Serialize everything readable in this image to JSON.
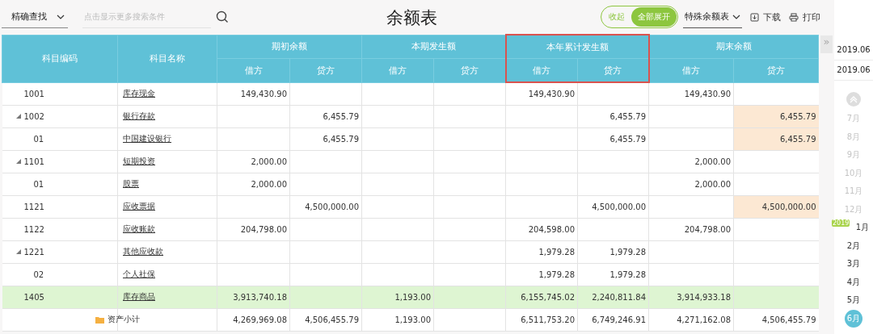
{
  "toolbar": {
    "search_mode": "精确查找",
    "search": {
      "placeholder": "点击显示更多搜索条件"
    },
    "title": "余额表",
    "toggle": [
      {
        "label": "收起",
        "selected": false
      },
      {
        "label": "全部展开",
        "selected": true
      }
    ],
    "report_type": "特殊余额表",
    "actions": [
      {
        "label": "下载",
        "kind": "download"
      },
      {
        "label": "打印",
        "kind": "print"
      }
    ]
  },
  "table": {
    "columns": [
      {
        "label": "科目编码"
      },
      {
        "label": "科目名称"
      }
    ],
    "groups": [
      {
        "label": "期初余额",
        "highlighted": false,
        "sub": [
          "借方",
          "贷方"
        ]
      },
      {
        "label": "本期发生额",
        "highlighted": false,
        "sub": [
          "借方",
          "贷方"
        ]
      },
      {
        "label": "本年累计发生额",
        "highlighted": true,
        "sub": [
          "借方",
          "贷方"
        ]
      },
      {
        "label": "期末余额",
        "highlighted": false,
        "sub": [
          "借方",
          "贷方"
        ]
      }
    ],
    "rows": [
      {
        "code": "1001",
        "name": "库存现金",
        "opening_debit": "149,430.90",
        "ytd_debit": "149,430.90",
        "closing_debit": "149,430.90",
        "highlighted": false,
        "warning": false
      },
      {
        "code": "1002",
        "name": "银行存款",
        "opening_credit": "6,455.79",
        "ytd_credit": "6,455.79",
        "closing_credit": "6,455.79",
        "highlighted": false,
        "warning": true,
        "expanded": true,
        "children": [
          {
            "code": "01",
            "name": "中国建设银行",
            "opening_credit": "6,455.79",
            "ytd_credit": "6,455.79",
            "closing_credit": "6,455.79",
            "highlighted": false,
            "warning": true
          }
        ]
      },
      {
        "code": "1101",
        "name": "短期投资",
        "opening_debit": "2,000.00",
        "closing_debit": "2,000.00",
        "highlighted": false,
        "warning": false,
        "expanded": true,
        "children": [
          {
            "code": "01",
            "name": "股票",
            "opening_debit": "2,000.00",
            "closing_debit": "2,000.00",
            "highlighted": false,
            "warning": false
          }
        ]
      },
      {
        "code": "1121",
        "name": "应收票据",
        "opening_credit": "4,500,000.00",
        "ytd_credit": "4,500,000.00",
        "closing_credit": "4,500,000.00",
        "highlighted": false,
        "warning": true
      },
      {
        "code": "1122",
        "name": "应收账款",
        "opening_debit": "204,798.00",
        "ytd_debit": "204,598.00",
        "closing_debit": "204,798.00",
        "highlighted": false,
        "warning": false
      },
      {
        "code": "1221",
        "name": "其他应收款",
        "ytd_debit": "1,979.28",
        "ytd_credit": "1,979.28",
        "highlighted": false,
        "warning": false,
        "expanded": true,
        "children": [
          {
            "code": "02",
            "name": "个人社保",
            "ytd_debit": "1,979.28",
            "ytd_credit": "1,979.28",
            "highlighted": false,
            "warning": false
          }
        ]
      },
      {
        "code": "1405",
        "name": "库存商品",
        "opening_debit": "3,913,740.18",
        "period_debit": "1,193.00",
        "ytd_debit": "6,155,745.02",
        "ytd_credit": "2,240,811.84",
        "closing_debit": "3,914,933.18",
        "highlighted": true,
        "warning": false
      }
    ],
    "subtotal": {
      "name": "资产小计",
      "opening_debit": "4,269,969.08",
      "opening_credit": "4,506,455.79",
      "period_debit": "1,193.00",
      "ytd_debit": "6,511,753.20",
      "ytd_credit": "6,749,246.91",
      "closing_debit": "4,271,162.08",
      "closing_credit": "4,506,455.79"
    }
  },
  "period_panel": {
    "collapse_symbol": "»",
    "periods": [
      "2019.06",
      "2019.06"
    ],
    "months": [
      {
        "label": "7月",
        "disabled": true,
        "selected": false
      },
      {
        "label": "8月",
        "disabled": true,
        "selected": false
      },
      {
        "label": "9月",
        "disabled": true,
        "selected": false
      },
      {
        "label": "10月",
        "disabled": true,
        "selected": false
      },
      {
        "label": "11月",
        "disabled": true,
        "selected": false
      },
      {
        "label": "12月",
        "disabled": true,
        "selected": false
      },
      {
        "label": "1月",
        "year_tag": "2019",
        "disabled": false,
        "selected": false
      },
      {
        "label": "2月",
        "disabled": false,
        "selected": false
      },
      {
        "label": "3月",
        "disabled": false,
        "selected": false
      },
      {
        "label": "4月",
        "disabled": false,
        "selected": false
      },
      {
        "label": "5月",
        "disabled": false,
        "selected": false
      },
      {
        "label": "6月",
        "disabled": false,
        "selected": true
      }
    ]
  }
}
